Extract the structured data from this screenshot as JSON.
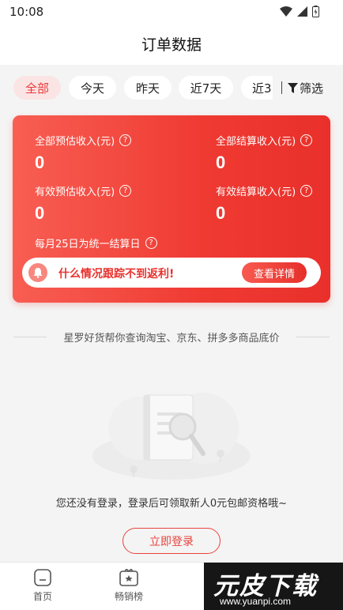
{
  "status_bar": {
    "time": "10:08"
  },
  "header": {
    "title": "订单数据"
  },
  "filters": {
    "chips": [
      "全部",
      "今天",
      "昨天",
      "近7天",
      "近3"
    ],
    "active_index": 0,
    "filter_label": "筛选"
  },
  "summary": {
    "total_estimated": {
      "label": "全部预估收入(元)",
      "value": "0"
    },
    "total_settled": {
      "label": "全部结算收入(元)",
      "value": "0"
    },
    "valid_estimated": {
      "label": "有效预估收入(元)",
      "value": "0"
    },
    "valid_settled": {
      "label": "有效结算收入(元)",
      "value": "0"
    },
    "settle_note": "每月25日为统一结算日",
    "alert_text": "什么情况跟踪不到返利!",
    "detail_button": "查看详情"
  },
  "divider_text": "星罗好货帮你查询淘宝、京东、拼多多商品底价",
  "empty_state": {
    "message": "您还没有登录，登录后可领取新人0元包邮资格哦~",
    "login_button": "立即登录"
  },
  "tabbar": {
    "items": [
      {
        "label": "首页",
        "icon": "home-icon"
      },
      {
        "label": "畅销榜",
        "icon": "ranking-icon"
      }
    ]
  },
  "watermark": {
    "title": "元皮下载",
    "url": "www.yuanpi.com"
  },
  "colors": {
    "accent": "#e83a38",
    "card_start": "#f85e53",
    "card_end": "#e9302b"
  }
}
